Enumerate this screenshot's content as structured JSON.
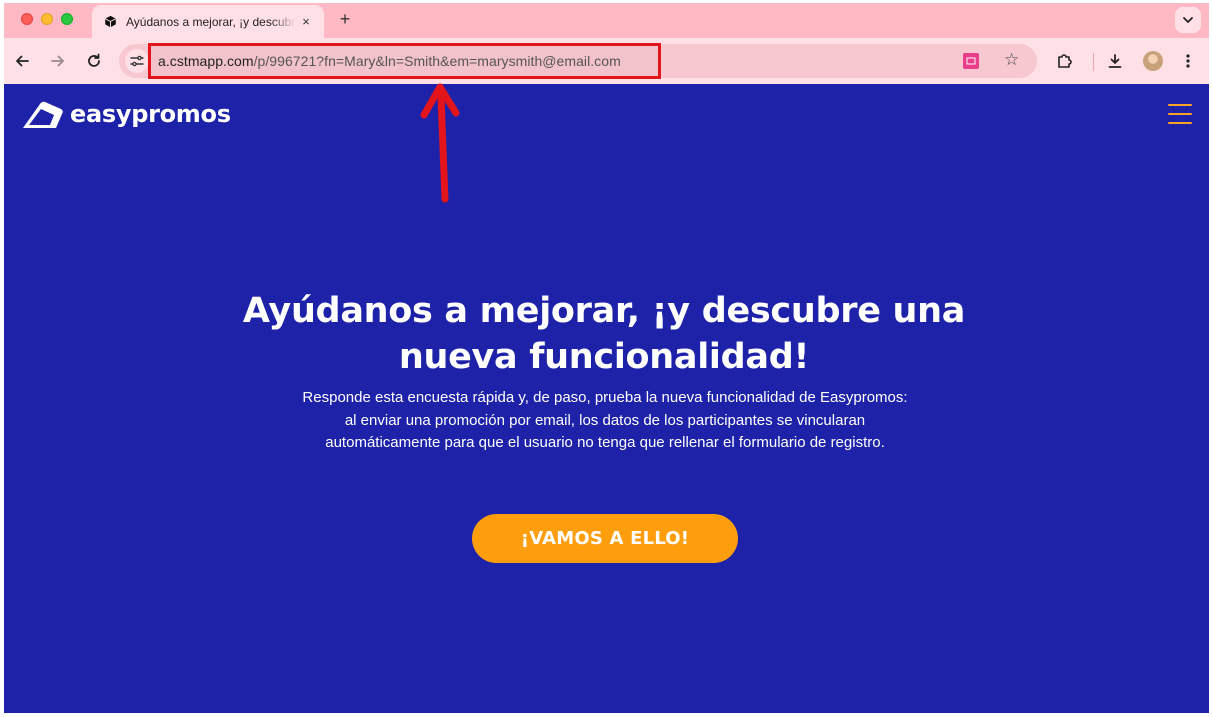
{
  "browser": {
    "tab": {
      "title": "Ayúdanos a mejorar, ¡y descubre una nueva funcionalidad!",
      "close": "×",
      "favicon": "cube-icon"
    },
    "new_tab_label": "+",
    "address_bar": {
      "host": "a.cstmapp.com",
      "path": "/p/996721?fn=Mary&ln=Smith&em=marysmith@email.com"
    },
    "icons": {
      "back": "arrow-left-icon",
      "forward": "arrow-right-icon",
      "reload": "reload-icon",
      "site_info": "tune-icon",
      "bookmark": "star-icon",
      "extensions": "puzzle-icon",
      "download": "download-icon",
      "menu": "kebab-menu-icon"
    },
    "colors": {
      "tab_strip": "#ffb9c5",
      "toolbar": "#ffe0e6",
      "highlight": "#e4141b"
    }
  },
  "page": {
    "brand": "easypromos",
    "hero": {
      "title": "Ayúdanos a mejorar, ¡y descubre una nueva funcionalidad!",
      "description": "Responde esta encuesta rápida y, de paso, prueba la nueva funcionalidad de Easypromos: al enviar una promoción por email, los datos de los participantes se vincularan automáticamente para que el usuario no tenga que rellenar el formulario de registro."
    },
    "cta_label": "¡VAMOS A ELLO!",
    "colors": {
      "background": "#1e22a8",
      "cta": "#ff9e0c",
      "menu_icon": "#f7a327"
    }
  }
}
